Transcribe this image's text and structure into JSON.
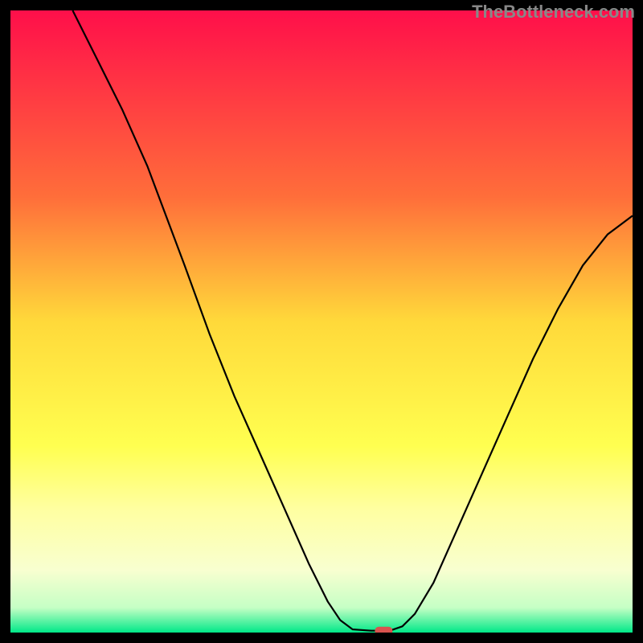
{
  "watermark": "TheBottleneck.com",
  "chart_data": {
    "type": "line",
    "title": "",
    "xlabel": "",
    "ylabel": "",
    "xlim": [
      0,
      100
    ],
    "ylim": [
      0,
      100
    ],
    "gradient_stops": [
      {
        "offset": 0,
        "color": "#FF0F4A"
      },
      {
        "offset": 30,
        "color": "#FF6E3A"
      },
      {
        "offset": 50,
        "color": "#FFD93A"
      },
      {
        "offset": 70,
        "color": "#FFFF50"
      },
      {
        "offset": 80,
        "color": "#FFFFA0"
      },
      {
        "offset": 90,
        "color": "#F8FFD0"
      },
      {
        "offset": 96,
        "color": "#C5FFC5"
      },
      {
        "offset": 100,
        "color": "#00E888"
      }
    ],
    "curve": [
      {
        "x": 10.0,
        "y": 100.0
      },
      {
        "x": 14.0,
        "y": 92.0
      },
      {
        "x": 18.0,
        "y": 84.0
      },
      {
        "x": 22.0,
        "y": 75.0
      },
      {
        "x": 25.0,
        "y": 67.0
      },
      {
        "x": 28.0,
        "y": 59.0
      },
      {
        "x": 32.0,
        "y": 48.0
      },
      {
        "x": 36.0,
        "y": 38.0
      },
      {
        "x": 40.0,
        "y": 29.0
      },
      {
        "x": 44.0,
        "y": 20.0
      },
      {
        "x": 48.0,
        "y": 11.0
      },
      {
        "x": 51.0,
        "y": 5.0
      },
      {
        "x": 53.0,
        "y": 2.0
      },
      {
        "x": 55.0,
        "y": 0.5
      },
      {
        "x": 58.0,
        "y": 0.3
      },
      {
        "x": 61.0,
        "y": 0.3
      },
      {
        "x": 63.0,
        "y": 1.0
      },
      {
        "x": 65.0,
        "y": 3.0
      },
      {
        "x": 68.0,
        "y": 8.0
      },
      {
        "x": 72.0,
        "y": 17.0
      },
      {
        "x": 76.0,
        "y": 26.0
      },
      {
        "x": 80.0,
        "y": 35.0
      },
      {
        "x": 84.0,
        "y": 44.0
      },
      {
        "x": 88.0,
        "y": 52.0
      },
      {
        "x": 92.0,
        "y": 59.0
      },
      {
        "x": 96.0,
        "y": 64.0
      },
      {
        "x": 100.0,
        "y": 67.0
      }
    ],
    "marker": {
      "x": 60.0,
      "y": 0.3,
      "color": "#D9534F"
    }
  }
}
